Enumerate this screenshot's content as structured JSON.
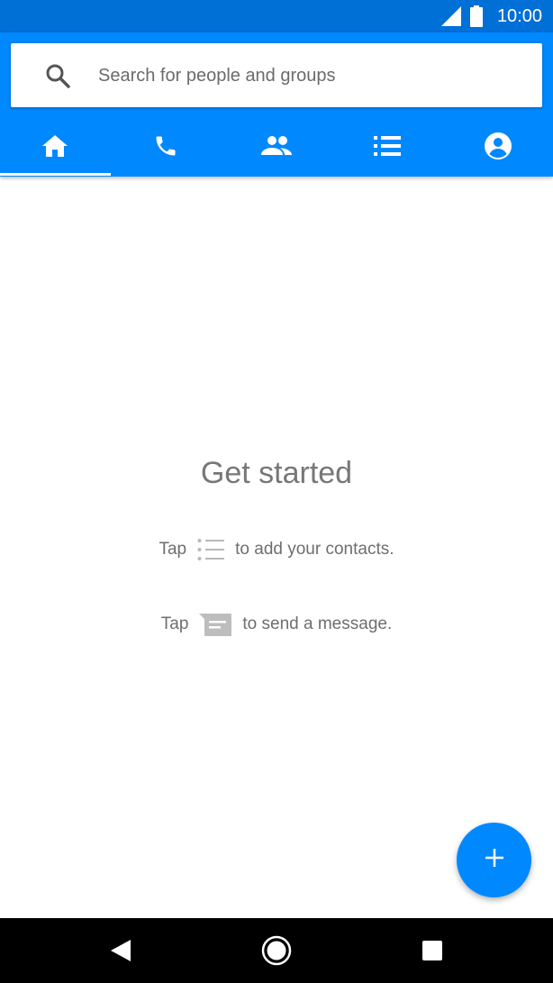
{
  "status_bar": {
    "time": "10:00"
  },
  "search": {
    "placeholder": "Search for people and groups"
  },
  "tabs": [
    {
      "icon": "home-icon",
      "selected": true
    },
    {
      "icon": "phone-icon",
      "selected": false
    },
    {
      "icon": "groups-icon",
      "selected": false
    },
    {
      "icon": "list-icon",
      "selected": false
    },
    {
      "icon": "account-circle-icon",
      "selected": false
    }
  ],
  "empty_state": {
    "title": "Get started",
    "hint_contacts": {
      "prefix": "Tap",
      "icon": "list-icon",
      "suffix": "to add your contacts."
    },
    "hint_message": {
      "prefix": "Tap",
      "icon": "message-icon",
      "suffix": "to send a message."
    }
  },
  "fab": {
    "icon": "plus-icon"
  },
  "nav_bar": {
    "buttons": [
      "back-icon",
      "home-circle-icon",
      "recents-icon"
    ]
  },
  "colors": {
    "accent": "#0088ff",
    "status_bar": "#006fd6",
    "text_muted": "#777777"
  }
}
